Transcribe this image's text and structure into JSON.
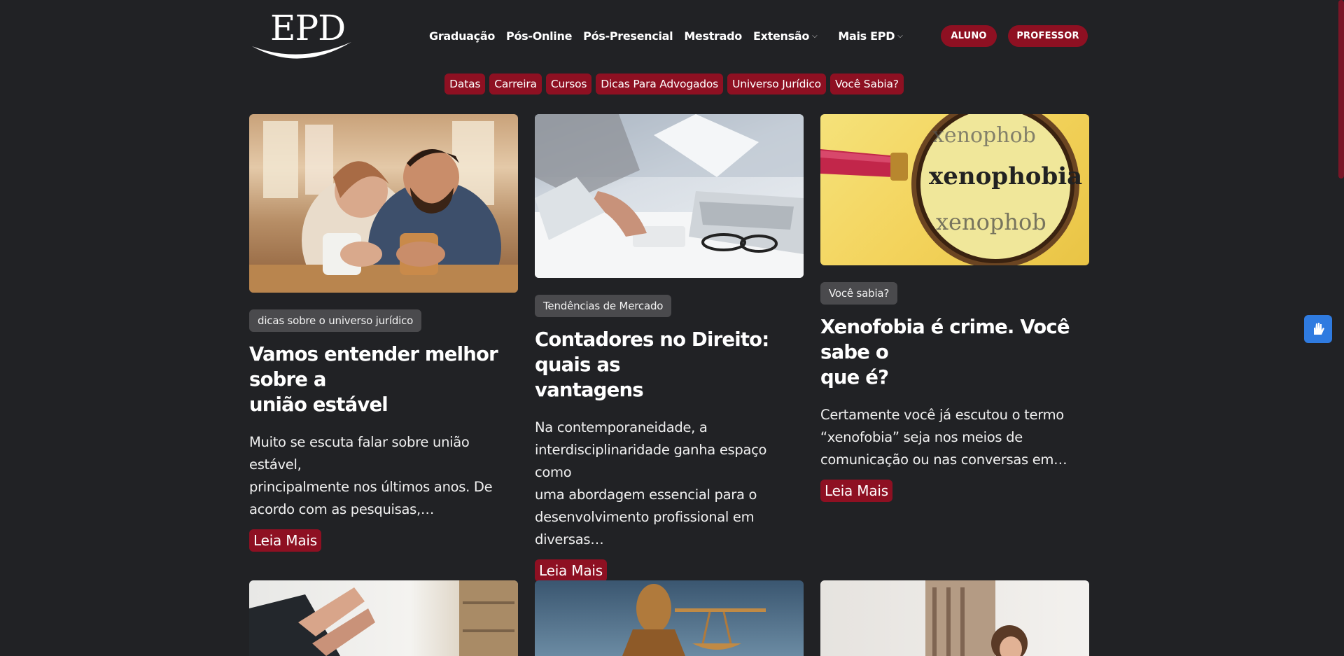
{
  "header": {
    "logo_text": "EPD",
    "nav": [
      {
        "label": "Graduação"
      },
      {
        "label": "Pós-Online"
      },
      {
        "label": "Pós-Presencial"
      },
      {
        "label": "Mestrado"
      },
      {
        "label": "Extensão",
        "dropdown": true
      },
      {
        "label": "Mais EPD",
        "dropdown": true
      }
    ],
    "aluno_label": "ALUNO",
    "professor_label": "PROFESSOR"
  },
  "categories": [
    "Datas",
    "Carreira",
    "Cursos",
    "Dicas Para Advogados",
    "Universo Jurídico",
    "Você Sabia?"
  ],
  "cards": [
    {
      "tag": "dicas sobre o universo jurídico",
      "title_lines": [
        "Vamos entender melhor sobre a",
        "união estável"
      ],
      "excerpt_lines": [
        "Muito se escuta falar sobre união estável,",
        "principalmente nos últimos anos. De",
        "acordo com as pesquisas,…"
      ],
      "more": "Leia Mais"
    },
    {
      "tag": "Tendências de Mercado",
      "title_lines": [
        "Contadores no Direito: quais as",
        "vantagens"
      ],
      "excerpt_lines": [
        "Na contemporaneidade, a",
        "interdisciplinaridade ganha espaço como",
        "uma abordagem essencial para o",
        "desenvolvimento profissional em",
        "diversas…"
      ],
      "more": "Leia Mais"
    },
    {
      "tag": "Você sabia?",
      "title_lines": [
        "Xenofobia é crime. Você sabe o",
        "que é?"
      ],
      "excerpt_lines": [
        "Certamente você já escutou o termo",
        "“xenofobia” seja nos meios de",
        "comunicação ou nas conversas em…"
      ],
      "more": "Leia Mais",
      "image_words": [
        "xenophob",
        "xenophobia",
        "xenophob"
      ]
    }
  ],
  "colors": {
    "background": "#212225",
    "accent": "#8e1022",
    "tag": "#4a4a4d"
  },
  "icons": {
    "a11y": "hand-sign-language-icon",
    "chevron": "chevron-down-icon"
  }
}
